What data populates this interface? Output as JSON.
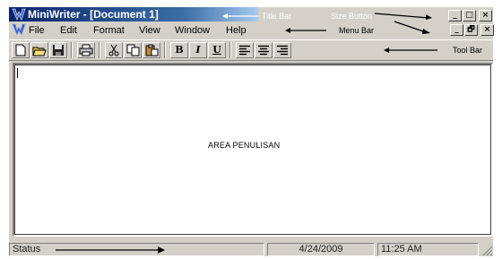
{
  "window": {
    "app_name": "MiniWriter",
    "title": "MiniWriter - [Document 1]",
    "controls": [
      "_",
      "□",
      "×"
    ],
    "doc_controls": [
      "_",
      "🗗",
      "×"
    ]
  },
  "annotations": {
    "title_bar": "Title Bar",
    "size_button": "Size Button",
    "menu_bar": "Menu Bar",
    "tool_bar": "Tool Bar"
  },
  "menu": {
    "items": [
      "File",
      "Edit",
      "Format",
      "View",
      "Window",
      "Help"
    ]
  },
  "toolbar": {
    "buttons": [
      {
        "name": "new-document-icon"
      },
      {
        "name": "open-folder-icon"
      },
      {
        "name": "save-disk-icon"
      },
      {
        "name": "print-icon"
      },
      {
        "name": "cut-scissors-icon"
      },
      {
        "name": "copy-icon"
      },
      {
        "name": "paste-icon"
      },
      {
        "name": "bold",
        "label": "B"
      },
      {
        "name": "italic",
        "label": "I"
      },
      {
        "name": "underline",
        "label": "U"
      },
      {
        "name": "align-left-icon"
      },
      {
        "name": "align-center-icon"
      },
      {
        "name": "align-right-icon"
      }
    ]
  },
  "editor": {
    "placeholder": "AREA PENULISAN"
  },
  "status": {
    "label": "Status",
    "date": "4/24/2009",
    "time": "11:25 AM"
  }
}
